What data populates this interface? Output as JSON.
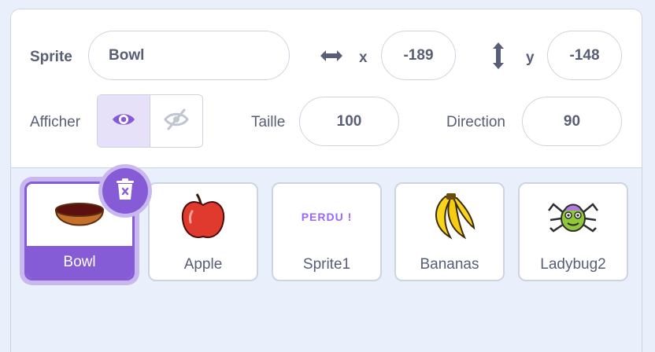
{
  "sprite_info": {
    "sprite_label": "Sprite",
    "sprite_name": "Bowl",
    "x_label": "x",
    "x_value": "-189",
    "y_label": "y",
    "y_value": "-148",
    "show_label": "Afficher",
    "show_state": "visible",
    "size_label": "Taille",
    "size_value": "100",
    "direction_label": "Direction",
    "direction_value": "90"
  },
  "sprites": [
    {
      "name": "Bowl",
      "thumb": "bowl",
      "selected": true
    },
    {
      "name": "Apple",
      "thumb": "apple",
      "selected": false
    },
    {
      "name": "Sprite1",
      "thumb": "lost",
      "thumb_text": "PERDU !",
      "selected": false
    },
    {
      "name": "Bananas",
      "thumb": "bananas",
      "selected": false
    },
    {
      "name": "Ladybug2",
      "thumb": "ladybug",
      "selected": false
    }
  ],
  "colors": {
    "accent": "#855cd6",
    "accent_light": "#c9b8f0",
    "text": "#575e75",
    "border": "#cdd4e0",
    "background": "#e9f0fb"
  }
}
